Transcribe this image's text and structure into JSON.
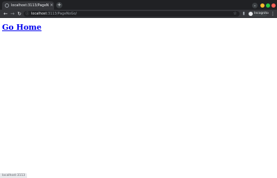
{
  "tab": {
    "favicon": "globe-icon",
    "title": "localhost:3113/PageNoGo/",
    "close": "×"
  },
  "tabstrip": {
    "new_tab": "+",
    "tab_search": "⌄"
  },
  "toolbar": {
    "back": "←",
    "forward": "→",
    "reload": "↻",
    "address": {
      "info": "ⓘ",
      "host": "localhost",
      "path": ":3113/PageNoGo/",
      "star": "☆"
    },
    "side_panel": "▮",
    "profile_label": "Incognito",
    "menu": "⋮"
  },
  "page": {
    "link_text": "Go Home"
  },
  "status_bar": {
    "url": "localhost:3113"
  },
  "colors": {
    "chrome_dark": "#202124",
    "toolbar": "#35363a",
    "link": "#0000ee",
    "win_min": "#febc2e",
    "win_max": "#28c840",
    "win_close": "#ff5f57"
  }
}
